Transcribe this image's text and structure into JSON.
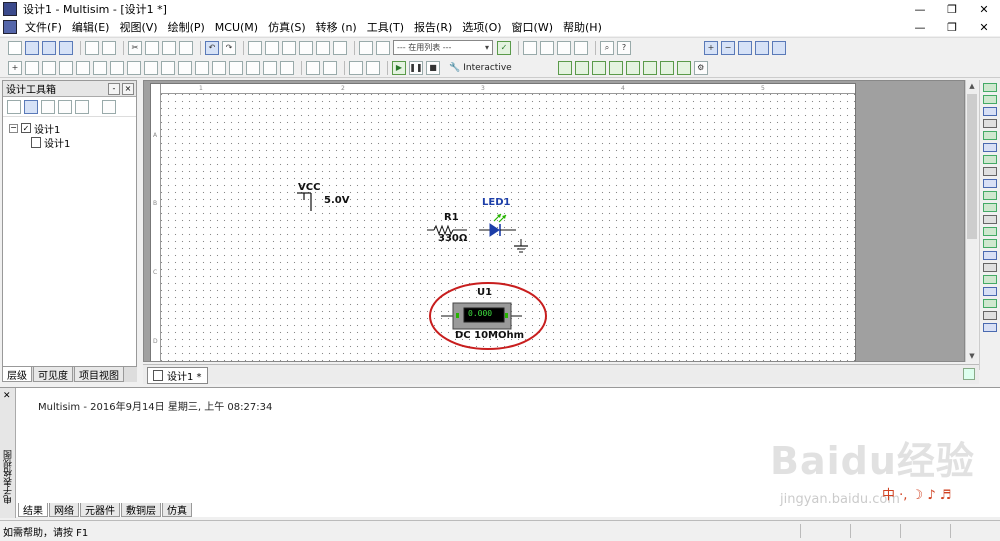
{
  "window": {
    "title": "设计1 - Multisim - [设计1 *]"
  },
  "menu": {
    "items": [
      "文件(F)",
      "编辑(E)",
      "视图(V)",
      "绘制(P)",
      "MCU(M)",
      "仿真(S)",
      "转移 (n)",
      "工具(T)",
      "报告(R)",
      "选项(O)",
      "窗口(W)",
      "帮助(H)"
    ]
  },
  "toolbar": {
    "in_use_list_placeholder": "--- 在用列表 ---",
    "interactive_label": "Interactive"
  },
  "design_toolbox": {
    "title": "设计工具箱",
    "tree": {
      "root": "设计1",
      "child": "设计1"
    },
    "tabs": [
      "层级",
      "可见度",
      "项目视图"
    ]
  },
  "schematic": {
    "vcc_label": "VCC",
    "vcc_value": "5.0V",
    "r1_label": "R1",
    "r1_value": "330Ω",
    "led_label": "LED1",
    "meter_label": "U1",
    "meter_reading": "0.000",
    "meter_mode": "DC  10MOhm",
    "ruler_top": [
      "1",
      "2",
      "3",
      "4",
      "5"
    ],
    "ruler_left": [
      "A",
      "B",
      "C",
      "D"
    ]
  },
  "document_tab": {
    "label": "设计1 *"
  },
  "spreadsheet": {
    "side_label": "电子表格视图",
    "log_line": "Multisim  -  2016年9月14日 星期三, 上午 08:27:34",
    "tabs": [
      "结果",
      "网络",
      "元器件",
      "敷铜层",
      "仿真"
    ]
  },
  "status": {
    "help_text": "如需帮助，请按 F1"
  },
  "watermark": {
    "brand": "Baidu经验",
    "sub": "jingyan.baidu.com"
  },
  "ime": {
    "glyphs": "中 ·, ☽ ♪ ♬"
  },
  "colors": {
    "accent_blue": "#1c3ea8",
    "annotation_red": "#c81e1e",
    "led_green": "#26b400"
  }
}
